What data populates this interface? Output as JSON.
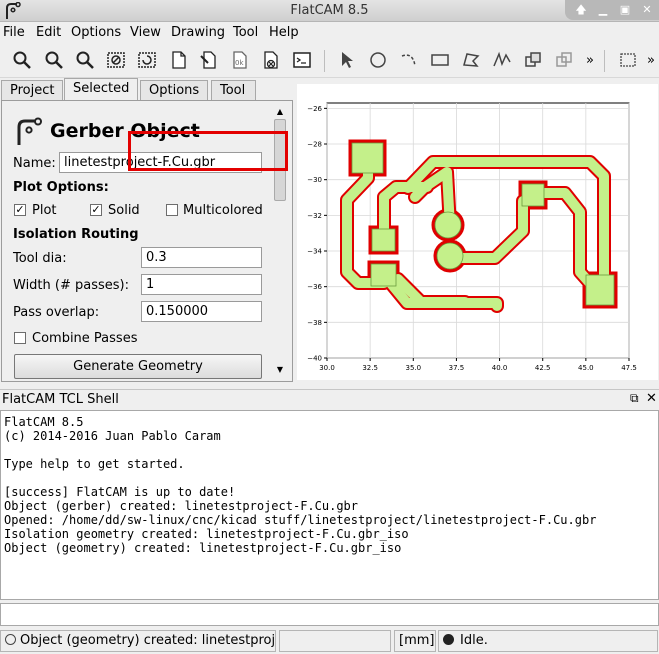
{
  "window": {
    "title": "FlatCAM 8.5",
    "controls": [
      "up",
      "minimize",
      "maximize",
      "close"
    ]
  },
  "menu": [
    "File",
    "Edit",
    "Options",
    "View",
    "Drawing",
    "Tool",
    "Help"
  ],
  "toolbar_icons": [
    "zoom-fit-icon",
    "zoom-in-icon",
    "zoom-out-icon",
    "clear-plot-icon",
    "replot-icon",
    "new-project-icon",
    "delete-icon",
    "toggle-icon",
    "close-object-icon",
    "shell-icon",
    "select-icon",
    "circle-icon",
    "arc-icon",
    "rectangle-icon",
    "polygon-icon",
    "path-icon",
    "move-icon",
    "copy-icon",
    "more-icon",
    "grid-icon"
  ],
  "tabs": [
    "Project",
    "Selected",
    "Options",
    "Tool"
  ],
  "active_tab": "Selected",
  "panel": {
    "title": "Gerber Object",
    "name_label": "Name:",
    "name_value": "linetestproject-F.Cu.gbr",
    "plot_options_label": "Plot Options:",
    "plot_label": "Plot",
    "solid_label": "Solid",
    "multicolored_label": "Multicolored",
    "plot_checked": true,
    "solid_checked": true,
    "multicolored_checked": false,
    "isolation_label": "Isolation Routing",
    "tool_dia_label": "Tool dia:",
    "tool_dia_value": "0.3",
    "width_label": "Width (# passes):",
    "width_value": "1",
    "pass_overlap_label": "Pass overlap:",
    "pass_overlap_value": "0.150000",
    "combine_label": "Combine Passes",
    "combine_checked": false,
    "generate_button": "Generate Geometry"
  },
  "chart_data": {
    "type": "other",
    "xticks": [
      "30.0",
      "32.5",
      "35.0",
      "37.5",
      "40.0",
      "42.5",
      "45.0",
      "47.5"
    ],
    "yticks": [
      "−26",
      "−28",
      "−30",
      "−32",
      "−34",
      "−36",
      "−38",
      "−40"
    ],
    "xlim": [
      30,
      47.5
    ],
    "ylim": [
      -40,
      -25.7
    ],
    "grid": true,
    "colors": {
      "fill": "#c4f08a",
      "fill_edge": "#6a9a3c",
      "iso": "#e00000"
    }
  },
  "shell": {
    "title": "FlatCAM TCL Shell",
    "lines": [
      "FlatCAM 8.5",
      "(c) 2014-2016 Juan Pablo Caram",
      "",
      "Type help to get started.",
      "",
      "[success] FlatCAM is up to date!",
      "Object (gerber) created: linetestproject-F.Cu.gbr",
      "Opened: /home/dd/sw-linux/cnc/kicad stuff/linetestproject/linetestproject-F.Cu.gbr",
      "Isolation geometry created: linetestproject-F.Cu.gbr_iso",
      "Object (geometry) created: linetestproject-F.Cu.gbr_iso"
    ],
    "input_value": ""
  },
  "status": {
    "message": "Object (geometry) created: linetestprojec",
    "units": "[mm]",
    "state": "Idle."
  }
}
